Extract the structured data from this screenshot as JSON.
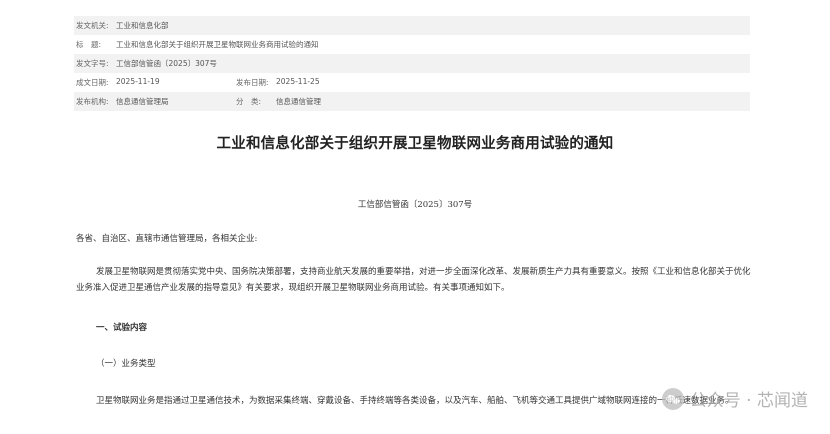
{
  "meta": {
    "issuer_label": "发文机关:",
    "issuer_value": "工业和信息化部",
    "subject_label": "标　题:",
    "subject_value": "工业和信息化部关于组织开展卫星物联网业务商用试验的通知",
    "docno_label": "发文字号:",
    "docno_value": "工信部信管函〔2025〕307号",
    "created_label": "成文日期:",
    "created_value": "2025-11-19",
    "published_label": "发布日期:",
    "published_value": "2025-11-25",
    "org_label": "发布机构:",
    "org_value": "信息通信管理局",
    "category_label": "分　类:",
    "category_value": "信息通信管理"
  },
  "document": {
    "title": "工业和信息化部关于组织开展卫星物联网业务商用试验的通知",
    "doc_number": "工信部信管函〔2025〕307号",
    "addressee": "各省、自治区、直辖市通信管理局，各相关企业:",
    "paragraph1": "发展卫星物联网是贯彻落实党中央、国务院决策部署，支持商业航天发展的重要举措，对进一步全面深化改革、发展新质生产力具有重要意义。按照《工业和信息化部关于优化业务准入促进卫星通信产业发展的指导意见》有关要求，现组织开展卫星物联网业务商用试验。有关事项通知如下。",
    "section1": "一、试验内容",
    "subsection1": "（一）业务类型",
    "paragraph2": "卫星物联网业务是指通过卫星通信技术，为数据采集终端、穿戴设备、手持终端等各类设备，以及汽车、船舶、飞机等交通工具提供广域物联网连接的一种低速数据业务。"
  },
  "watermark": {
    "icon": "wechat-icon",
    "text": "公众号 · 芯闻道"
  }
}
